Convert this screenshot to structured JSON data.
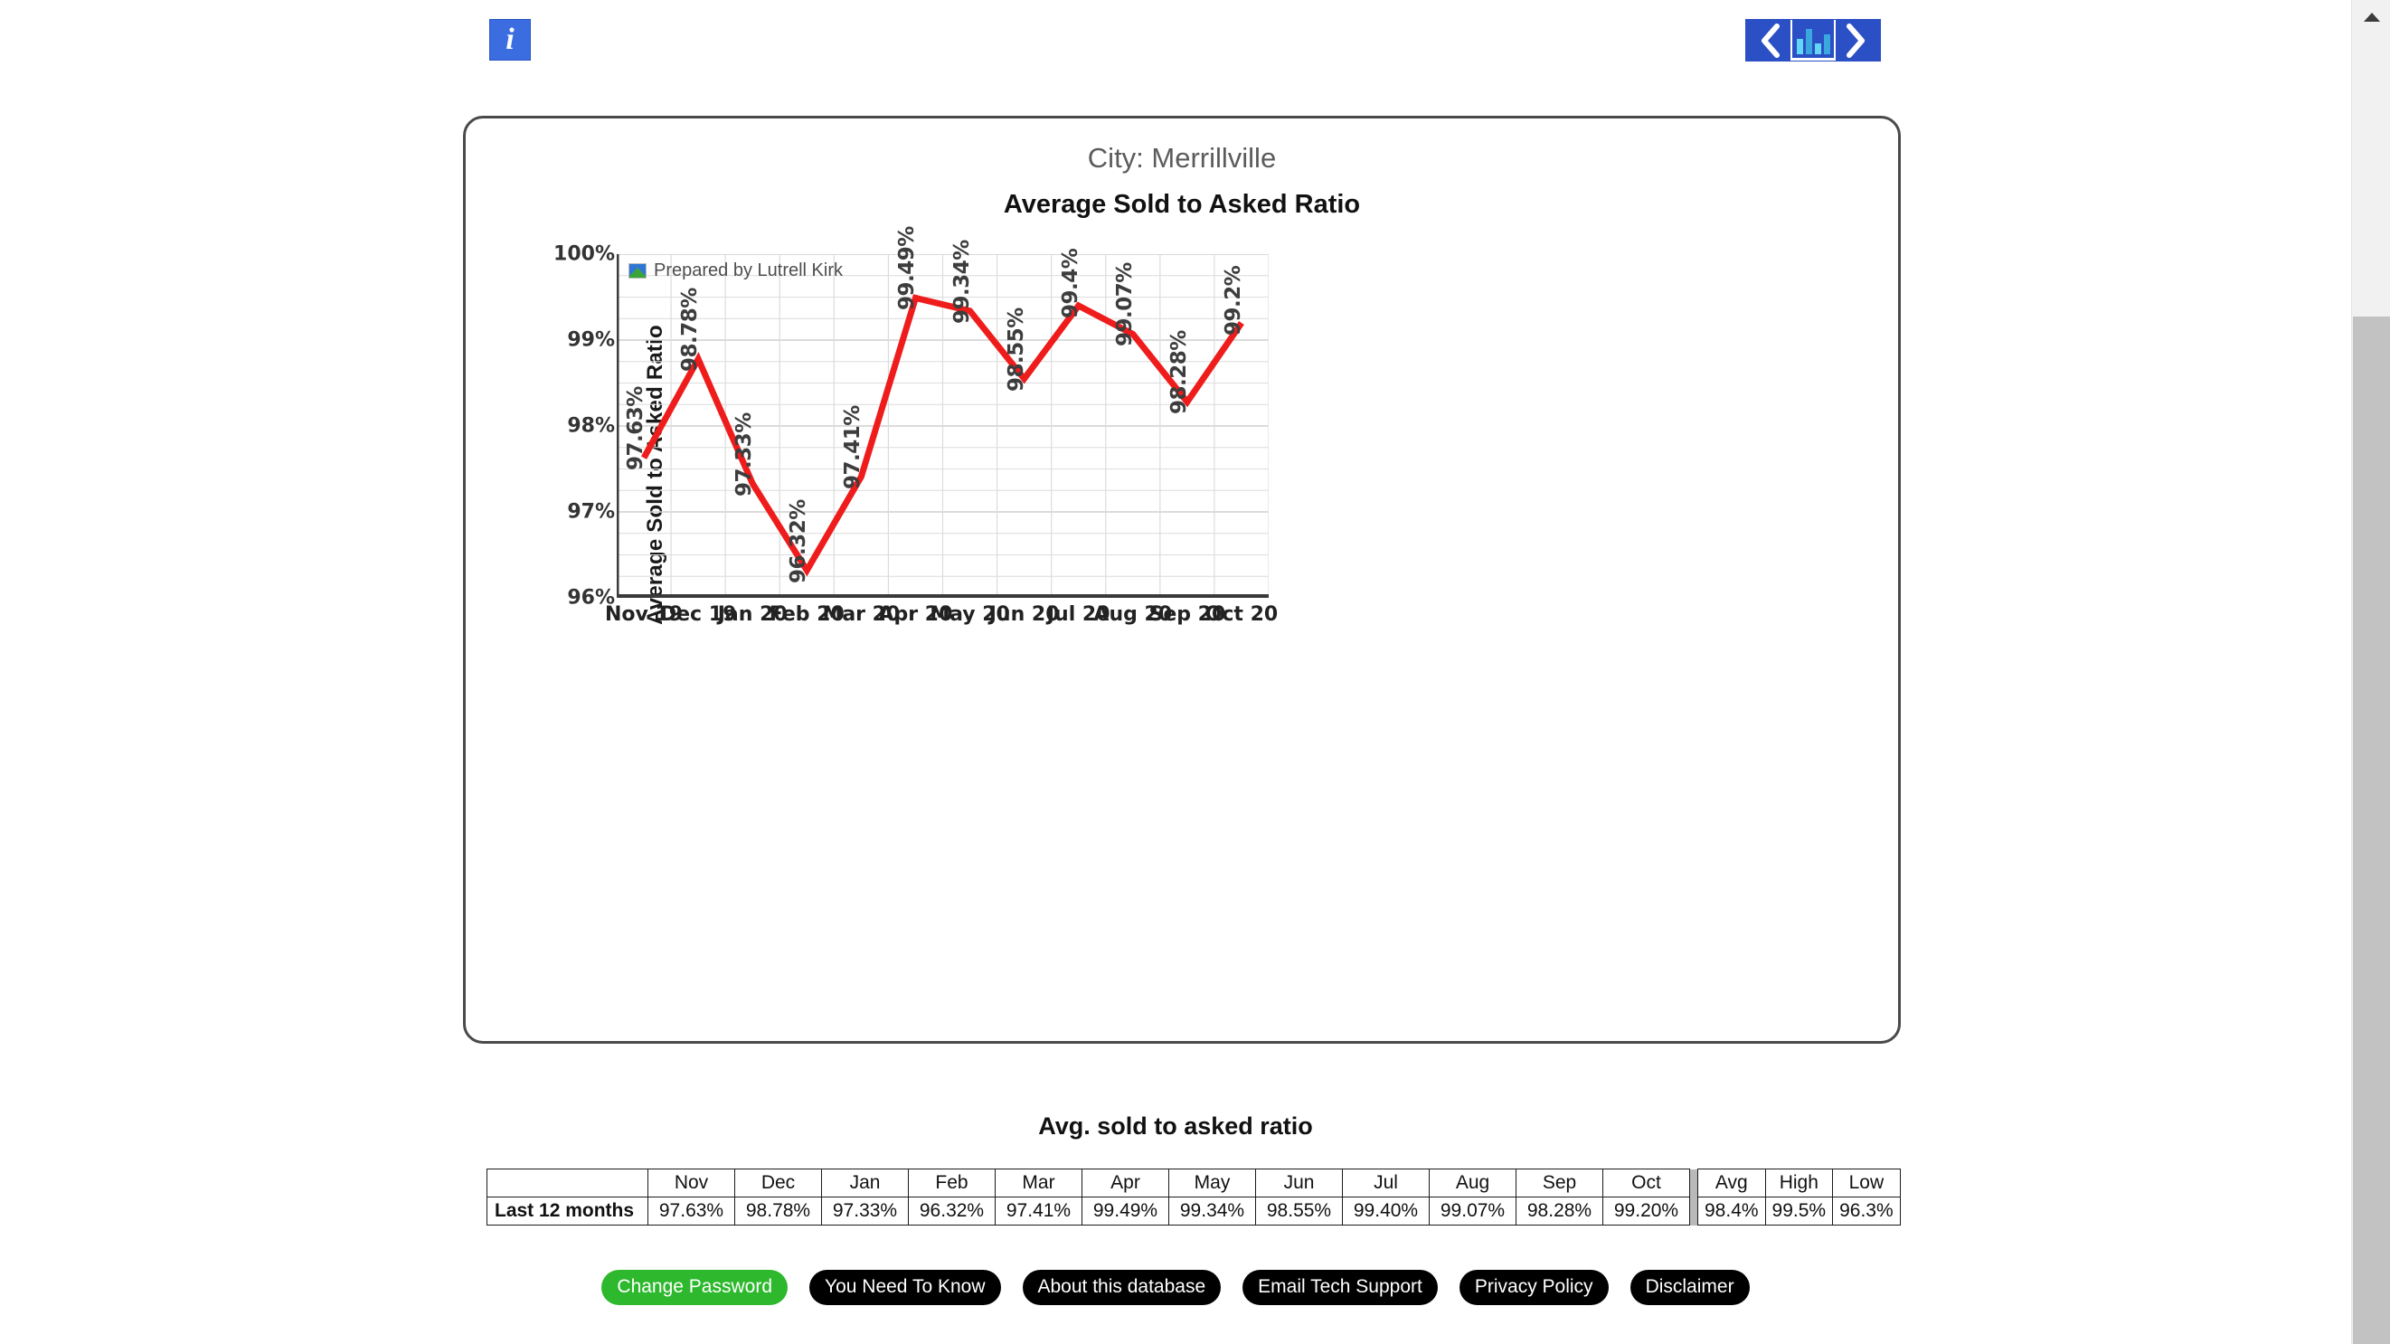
{
  "toolbar": {
    "info_icon": "info-icon",
    "info_glyph": "i",
    "prev_label": "‹",
    "chart_icon": "bar-chart-icon",
    "next_label": "›"
  },
  "chart_card": {
    "city_line": "City: Merrillville",
    "title": "Average Sold to Asked Ratio",
    "watermark": "Prepared by Lutrell Kirk"
  },
  "chart_data": {
    "type": "line",
    "title": "Average Sold to Asked Ratio",
    "subtitle": "City: Merrillville",
    "xlabel": "",
    "ylabel": "Average Sold to Asked Ratio",
    "ylim": [
      96,
      100
    ],
    "yticks": [
      "96%",
      "97%",
      "98%",
      "99%",
      "100%"
    ],
    "ytick_values": [
      96,
      97,
      98,
      99,
      100
    ],
    "minor_tick_step": 0.25,
    "grid": true,
    "legend": "none",
    "line_color": "#ef1c1c",
    "categories": [
      "Nov 19",
      "Dec 19",
      "Jan 20",
      "Feb 20",
      "Mar 20",
      "Apr 20",
      "May 20",
      "Jun 20",
      "Jul 20",
      "Aug 20",
      "Sep 20",
      "Oct 20"
    ],
    "values": [
      97.63,
      98.78,
      97.33,
      96.32,
      97.41,
      99.49,
      99.34,
      98.55,
      99.4,
      99.07,
      98.28,
      99.2
    ],
    "point_labels": [
      "97.63%",
      "98.78%",
      "97.33%",
      "96.32%",
      "97.41%",
      "99.49%",
      "99.34%",
      "98.55%",
      "99.4%",
      "99.07%",
      "98.28%",
      "99.2%"
    ],
    "annotation": "Prepared by Lutrell Kirk"
  },
  "table_section": {
    "heading": "Avg. sold to asked ratio",
    "headers": [
      "",
      "Nov",
      "Dec",
      "Jan",
      "Feb",
      "Mar",
      "Apr",
      "May",
      "Jun",
      "Jul",
      "Aug",
      "Sep",
      "Oct",
      "Avg",
      "High",
      "Low"
    ],
    "row_label": "Last 12 months",
    "values": [
      "97.63%",
      "98.78%",
      "97.33%",
      "96.32%",
      "97.41%",
      "99.49%",
      "99.34%",
      "98.55%",
      "99.40%",
      "99.07%",
      "98.28%",
      "99.20%"
    ],
    "summary": [
      "98.4%",
      "99.5%",
      "96.3%"
    ]
  },
  "buttons": [
    {
      "label": "Change Password",
      "color": "#2db82d"
    },
    {
      "label": "You Need To Know",
      "color": "#000000"
    },
    {
      "label": "About this database",
      "color": "#000000"
    },
    {
      "label": "Email Tech Support",
      "color": "#000000"
    },
    {
      "label": "Privacy Policy",
      "color": "#000000"
    },
    {
      "label": "Disclaimer",
      "color": "#000000"
    }
  ],
  "footer": {
    "text": ""
  }
}
